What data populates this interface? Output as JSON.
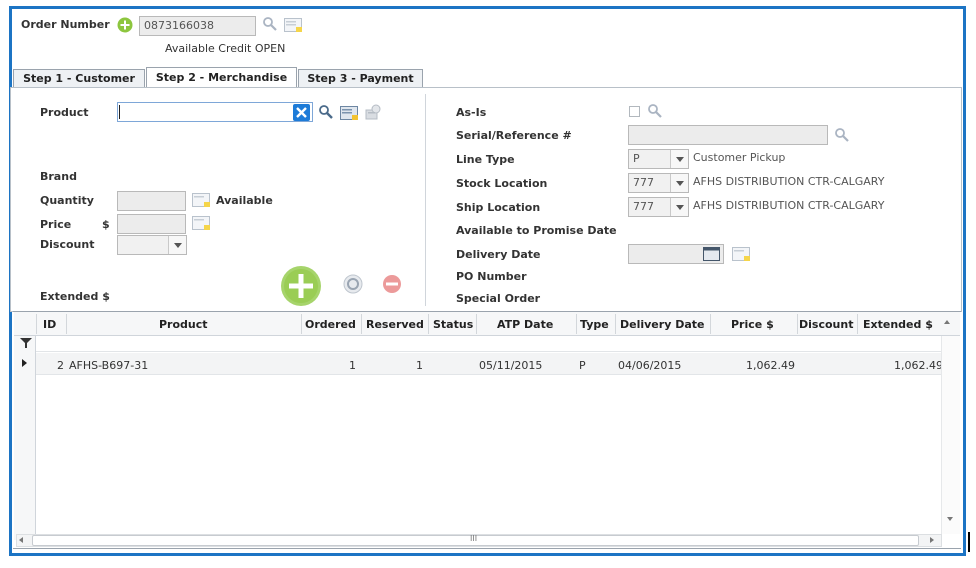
{
  "header": {
    "order_number_label": "Order Number",
    "order_number_value": "0873166038",
    "available_credit": "Available Credit OPEN"
  },
  "tabs": [
    {
      "label": "Step 1 - Customer",
      "active": false
    },
    {
      "label": "Step 2 - Merchandise",
      "active": true
    },
    {
      "label": "Step 3 - Payment",
      "active": false
    }
  ],
  "left_form": {
    "product_label": "Product",
    "product_value": "",
    "brand_label": "Brand",
    "quantity_label": "Quantity",
    "available_label": "Available",
    "price_label": "Price",
    "currency_symbol": "$",
    "discount_label": "Discount",
    "extended_label": "Extended $"
  },
  "right_form": {
    "as_is_label": "As-Is",
    "serial_label": "Serial/Reference #",
    "line_type_label": "Line Type",
    "line_type_value": "P",
    "line_type_desc": "Customer Pickup",
    "stock_location_label": "Stock Location",
    "stock_location_value": "777",
    "stock_location_desc": "AFHS DISTRIBUTION CTR-CALGARY",
    "ship_location_label": "Ship Location",
    "ship_location_value": "777",
    "ship_location_desc": "AFHS DISTRIBUTION CTR-CALGARY",
    "atp_label": "Available to Promise Date",
    "delivery_date_label": "Delivery Date",
    "po_number_label": "PO Number",
    "special_order_label": "Special Order"
  },
  "grid": {
    "columns": [
      "ID",
      "Product",
      "Ordered",
      "Reserved",
      "Status",
      "ATP Date",
      "Type",
      "Delivery Date",
      "Price $",
      "Discount",
      "Extended $"
    ],
    "rows": [
      {
        "id": "2",
        "product": "AFHS-B697-31",
        "ordered": "1",
        "reserved": "1",
        "status": "",
        "atp_date": "05/11/2015",
        "type": "P",
        "delivery_date": "04/06/2015",
        "price": "1,062.49",
        "discount": "",
        "extended": "1,062.49"
      }
    ],
    "scroll_thumb_glyph": "III"
  },
  "colors": {
    "frame_border": "#1c74c4",
    "add_green": "#8dc63f",
    "remove_red": "#e26b6b",
    "clear_blue": "#1d7bd8"
  }
}
